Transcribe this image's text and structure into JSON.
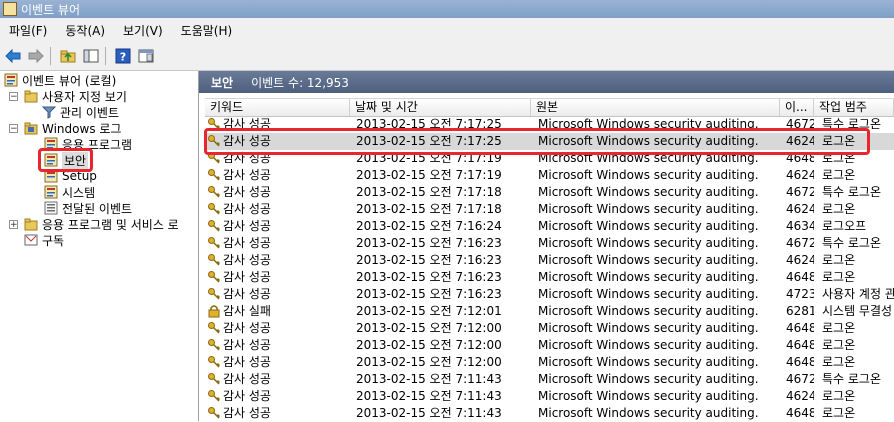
{
  "window": {
    "title": "이벤트 뷰어"
  },
  "menu": [
    "파일(F)",
    "동작(A)",
    "보기(V)",
    "도움말(H)"
  ],
  "toolbar": [
    "back-arrow-icon",
    "forward-arrow-icon",
    "up-folder-icon",
    "show-hide-tree-icon",
    "help-icon",
    "properties-icon"
  ],
  "tree": {
    "root": "이벤트 뷰어 (로컬)",
    "custom_views": "사용자 지정 보기",
    "admin_events": "관리 이벤트",
    "windows_logs": "Windows 로그",
    "application": "응용 프로그램",
    "security": "보안",
    "setup": "Setup",
    "system": "시스템",
    "forwarded": "전달된 이벤트",
    "app_services": "응용 프로그램 및 서비스 로",
    "subscriptions": "구독"
  },
  "panel": {
    "title": "보안",
    "count": "이벤트 수: 12,953"
  },
  "columns": [
    "키워드",
    "날짜 및 시간",
    "원본",
    "이...",
    "작업 범주"
  ],
  "events": [
    {
      "keyword": "감사 성공",
      "datetime": "2013-02-15 오전 7:17:25",
      "source": "Microsoft Windows security auditing.",
      "id": "4672",
      "category": "특수 로그온",
      "icon": "key"
    },
    {
      "keyword": "감사 성공",
      "datetime": "2013-02-15 오전 7:17:25",
      "source": "Microsoft Windows security auditing.",
      "id": "4624",
      "category": "로그온",
      "icon": "key"
    },
    {
      "keyword": "감사 성공",
      "datetime": "2013-02-15 오전 7:17:19",
      "source": "Microsoft Windows security auditing.",
      "id": "4648",
      "category": "로그온",
      "icon": "key"
    },
    {
      "keyword": "감사 성공",
      "datetime": "2013-02-15 오전 7:17:19",
      "source": "Microsoft Windows security auditing.",
      "id": "4624",
      "category": "로그온",
      "icon": "key"
    },
    {
      "keyword": "감사 성공",
      "datetime": "2013-02-15 오전 7:17:18",
      "source": "Microsoft Windows security auditing.",
      "id": "4672",
      "category": "특수 로그온",
      "icon": "key"
    },
    {
      "keyword": "감사 성공",
      "datetime": "2013-02-15 오전 7:17:18",
      "source": "Microsoft Windows security auditing.",
      "id": "4624",
      "category": "로그온",
      "icon": "key"
    },
    {
      "keyword": "감사 성공",
      "datetime": "2013-02-15 오전 7:16:24",
      "source": "Microsoft Windows security auditing.",
      "id": "4634",
      "category": "로그오프",
      "icon": "key"
    },
    {
      "keyword": "감사 성공",
      "datetime": "2013-02-15 오전 7:16:23",
      "source": "Microsoft Windows security auditing.",
      "id": "4672",
      "category": "특수 로그온",
      "icon": "key"
    },
    {
      "keyword": "감사 성공",
      "datetime": "2013-02-15 오전 7:16:23",
      "source": "Microsoft Windows security auditing.",
      "id": "4624",
      "category": "로그온",
      "icon": "key"
    },
    {
      "keyword": "감사 성공",
      "datetime": "2013-02-15 오전 7:16:23",
      "source": "Microsoft Windows security auditing.",
      "id": "4648",
      "category": "로그온",
      "icon": "key"
    },
    {
      "keyword": "감사 성공",
      "datetime": "2013-02-15 오전 7:16:23",
      "source": "Microsoft Windows security auditing.",
      "id": "4723",
      "category": "사용자 계정 관",
      "icon": "key"
    },
    {
      "keyword": "감사 실패",
      "datetime": "2013-02-15 오전 7:12:01",
      "source": "Microsoft Windows security auditing.",
      "id": "6281",
      "category": "시스템 무결성",
      "icon": "lock"
    },
    {
      "keyword": "감사 성공",
      "datetime": "2013-02-15 오전 7:12:00",
      "source": "Microsoft Windows security auditing.",
      "id": "4648",
      "category": "로그온",
      "icon": "key"
    },
    {
      "keyword": "감사 성공",
      "datetime": "2013-02-15 오전 7:12:00",
      "source": "Microsoft Windows security auditing.",
      "id": "4648",
      "category": "로그온",
      "icon": "key"
    },
    {
      "keyword": "감사 성공",
      "datetime": "2013-02-15 오전 7:12:00",
      "source": "Microsoft Windows security auditing.",
      "id": "4648",
      "category": "로그온",
      "icon": "key"
    },
    {
      "keyword": "감사 성공",
      "datetime": "2013-02-15 오전 7:11:43",
      "source": "Microsoft Windows security auditing.",
      "id": "4672",
      "category": "특수 로그온",
      "icon": "key"
    },
    {
      "keyword": "감사 성공",
      "datetime": "2013-02-15 오전 7:11:43",
      "source": "Microsoft Windows security auditing.",
      "id": "4624",
      "category": "로그온",
      "icon": "key"
    },
    {
      "keyword": "감사 성공",
      "datetime": "2013-02-15 오전 7:11:43",
      "source": "Microsoft Windows security auditing.",
      "id": "4648",
      "category": "로그온",
      "icon": "key"
    }
  ],
  "selected_row": 1,
  "colors": {
    "highlight": "#e8262d",
    "header": "#4e5f7e",
    "selection": "#d8d8d8"
  }
}
